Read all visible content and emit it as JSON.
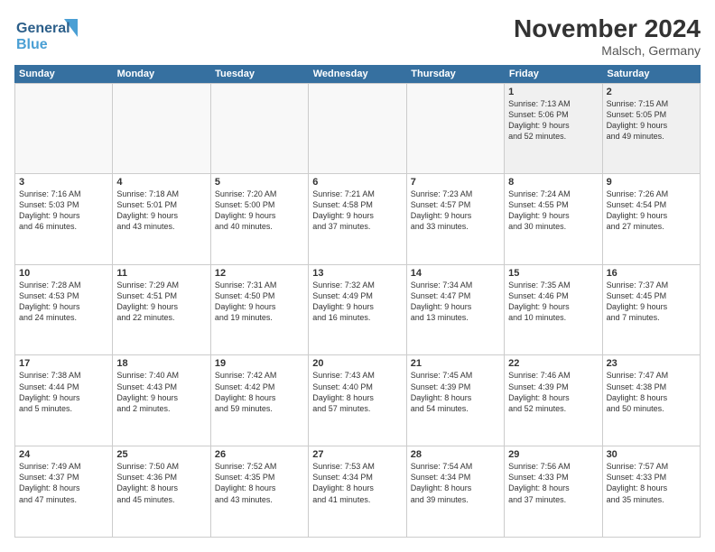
{
  "header": {
    "logo_line1": "General",
    "logo_line2": "Blue",
    "month": "November 2024",
    "location": "Malsch, Germany"
  },
  "weekdays": [
    "Sunday",
    "Monday",
    "Tuesday",
    "Wednesday",
    "Thursday",
    "Friday",
    "Saturday"
  ],
  "weeks": [
    [
      {
        "day": "",
        "info": ""
      },
      {
        "day": "",
        "info": ""
      },
      {
        "day": "",
        "info": ""
      },
      {
        "day": "",
        "info": ""
      },
      {
        "day": "",
        "info": ""
      },
      {
        "day": "1",
        "info": "Sunrise: 7:13 AM\nSunset: 5:06 PM\nDaylight: 9 hours\nand 52 minutes."
      },
      {
        "day": "2",
        "info": "Sunrise: 7:15 AM\nSunset: 5:05 PM\nDaylight: 9 hours\nand 49 minutes."
      }
    ],
    [
      {
        "day": "3",
        "info": "Sunrise: 7:16 AM\nSunset: 5:03 PM\nDaylight: 9 hours\nand 46 minutes."
      },
      {
        "day": "4",
        "info": "Sunrise: 7:18 AM\nSunset: 5:01 PM\nDaylight: 9 hours\nand 43 minutes."
      },
      {
        "day": "5",
        "info": "Sunrise: 7:20 AM\nSunset: 5:00 PM\nDaylight: 9 hours\nand 40 minutes."
      },
      {
        "day": "6",
        "info": "Sunrise: 7:21 AM\nSunset: 4:58 PM\nDaylight: 9 hours\nand 37 minutes."
      },
      {
        "day": "7",
        "info": "Sunrise: 7:23 AM\nSunset: 4:57 PM\nDaylight: 9 hours\nand 33 minutes."
      },
      {
        "day": "8",
        "info": "Sunrise: 7:24 AM\nSunset: 4:55 PM\nDaylight: 9 hours\nand 30 minutes."
      },
      {
        "day": "9",
        "info": "Sunrise: 7:26 AM\nSunset: 4:54 PM\nDaylight: 9 hours\nand 27 minutes."
      }
    ],
    [
      {
        "day": "10",
        "info": "Sunrise: 7:28 AM\nSunset: 4:53 PM\nDaylight: 9 hours\nand 24 minutes."
      },
      {
        "day": "11",
        "info": "Sunrise: 7:29 AM\nSunset: 4:51 PM\nDaylight: 9 hours\nand 22 minutes."
      },
      {
        "day": "12",
        "info": "Sunrise: 7:31 AM\nSunset: 4:50 PM\nDaylight: 9 hours\nand 19 minutes."
      },
      {
        "day": "13",
        "info": "Sunrise: 7:32 AM\nSunset: 4:49 PM\nDaylight: 9 hours\nand 16 minutes."
      },
      {
        "day": "14",
        "info": "Sunrise: 7:34 AM\nSunset: 4:47 PM\nDaylight: 9 hours\nand 13 minutes."
      },
      {
        "day": "15",
        "info": "Sunrise: 7:35 AM\nSunset: 4:46 PM\nDaylight: 9 hours\nand 10 minutes."
      },
      {
        "day": "16",
        "info": "Sunrise: 7:37 AM\nSunset: 4:45 PM\nDaylight: 9 hours\nand 7 minutes."
      }
    ],
    [
      {
        "day": "17",
        "info": "Sunrise: 7:38 AM\nSunset: 4:44 PM\nDaylight: 9 hours\nand 5 minutes."
      },
      {
        "day": "18",
        "info": "Sunrise: 7:40 AM\nSunset: 4:43 PM\nDaylight: 9 hours\nand 2 minutes."
      },
      {
        "day": "19",
        "info": "Sunrise: 7:42 AM\nSunset: 4:42 PM\nDaylight: 8 hours\nand 59 minutes."
      },
      {
        "day": "20",
        "info": "Sunrise: 7:43 AM\nSunset: 4:40 PM\nDaylight: 8 hours\nand 57 minutes."
      },
      {
        "day": "21",
        "info": "Sunrise: 7:45 AM\nSunset: 4:39 PM\nDaylight: 8 hours\nand 54 minutes."
      },
      {
        "day": "22",
        "info": "Sunrise: 7:46 AM\nSunset: 4:39 PM\nDaylight: 8 hours\nand 52 minutes."
      },
      {
        "day": "23",
        "info": "Sunrise: 7:47 AM\nSunset: 4:38 PM\nDaylight: 8 hours\nand 50 minutes."
      }
    ],
    [
      {
        "day": "24",
        "info": "Sunrise: 7:49 AM\nSunset: 4:37 PM\nDaylight: 8 hours\nand 47 minutes."
      },
      {
        "day": "25",
        "info": "Sunrise: 7:50 AM\nSunset: 4:36 PM\nDaylight: 8 hours\nand 45 minutes."
      },
      {
        "day": "26",
        "info": "Sunrise: 7:52 AM\nSunset: 4:35 PM\nDaylight: 8 hours\nand 43 minutes."
      },
      {
        "day": "27",
        "info": "Sunrise: 7:53 AM\nSunset: 4:34 PM\nDaylight: 8 hours\nand 41 minutes."
      },
      {
        "day": "28",
        "info": "Sunrise: 7:54 AM\nSunset: 4:34 PM\nDaylight: 8 hours\nand 39 minutes."
      },
      {
        "day": "29",
        "info": "Sunrise: 7:56 AM\nSunset: 4:33 PM\nDaylight: 8 hours\nand 37 minutes."
      },
      {
        "day": "30",
        "info": "Sunrise: 7:57 AM\nSunset: 4:33 PM\nDaylight: 8 hours\nand 35 minutes."
      }
    ]
  ]
}
